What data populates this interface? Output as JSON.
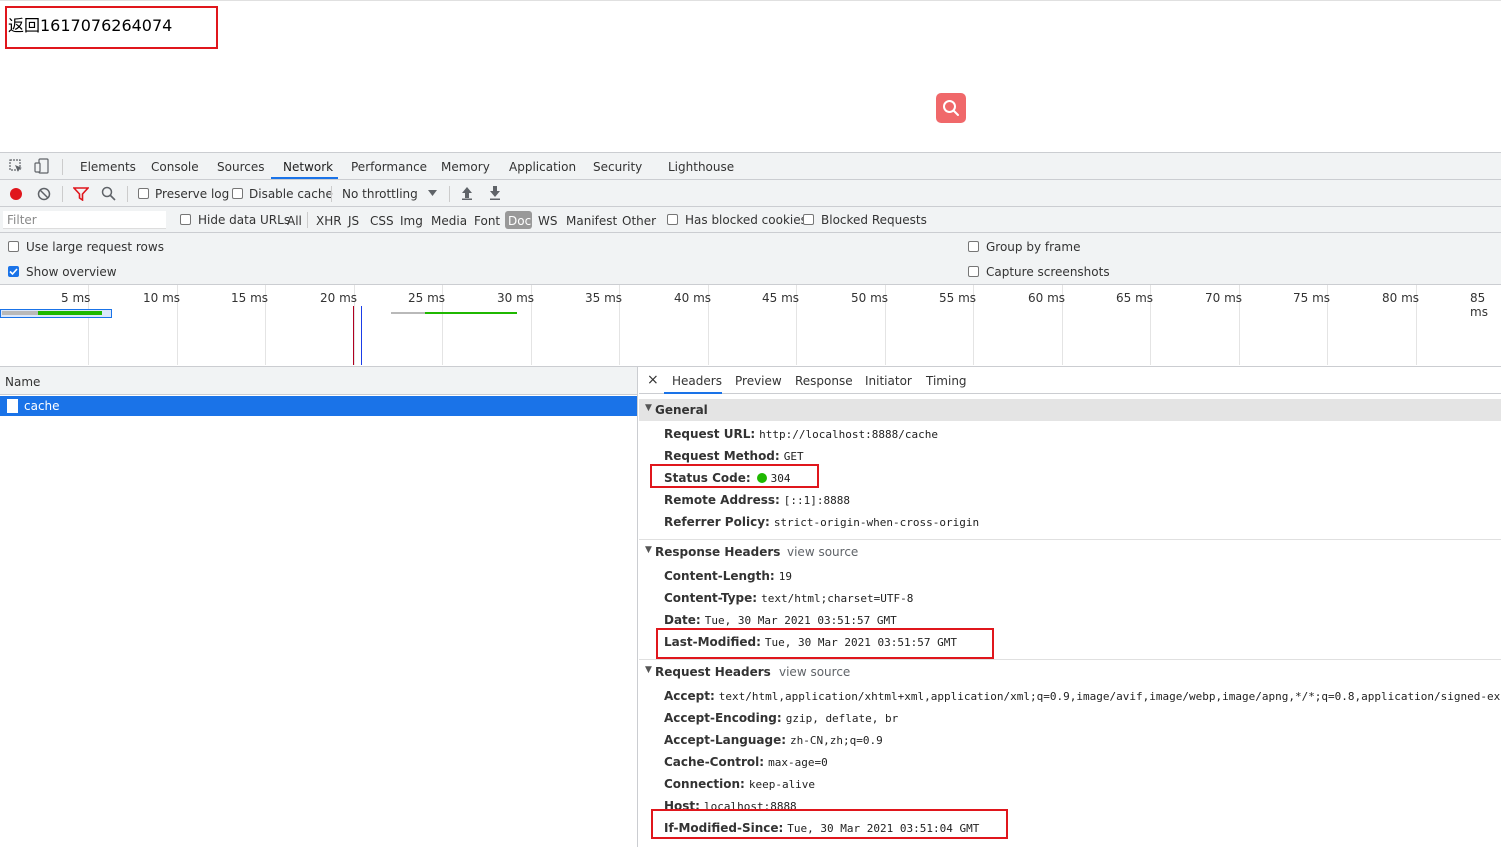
{
  "page": {
    "text": "返回1617076264074"
  },
  "devtools": {
    "tabs": [
      "Elements",
      "Console",
      "Sources",
      "Network",
      "Performance",
      "Memory",
      "Application",
      "Security",
      "Lighthouse"
    ],
    "toolbar": {
      "preserve_log": "Preserve log",
      "disable_cache": "Disable cache",
      "throttling": "No throttling"
    },
    "filter": {
      "placeholder": "Filter",
      "hide_data_urls": "Hide data URLs",
      "types": [
        "All",
        "XHR",
        "JS",
        "CSS",
        "Img",
        "Media",
        "Font",
        "Doc",
        "WS",
        "Manifest",
        "Other"
      ],
      "selected_type": "Doc",
      "has_blocked_cookies": "Has blocked cookies",
      "blocked_requests": "Blocked Requests"
    },
    "options": {
      "use_large_rows": "Use large request rows",
      "show_overview": "Show overview",
      "group_by_frame": "Group by frame",
      "capture_screenshots": "Capture screenshots"
    },
    "overview": {
      "ticks": [
        "5 ms",
        "10 ms",
        "15 ms",
        "20 ms",
        "25 ms",
        "30 ms",
        "35 ms",
        "40 ms",
        "45 ms",
        "50 ms",
        "55 ms",
        "60 ms",
        "65 ms",
        "70 ms",
        "75 ms",
        "80 ms",
        "85 ms"
      ]
    },
    "requests": {
      "column_name": "Name",
      "rows": [
        "cache"
      ]
    },
    "details": {
      "tabs": [
        "Headers",
        "Preview",
        "Response",
        "Initiator",
        "Timing"
      ],
      "close": "×",
      "general": {
        "title": "General",
        "rows": [
          {
            "key": "Request URL:",
            "value": "http://localhost:8888/cache"
          },
          {
            "key": "Request Method:",
            "value": "GET"
          },
          {
            "key": "Status Code:",
            "value": "304"
          },
          {
            "key": "Remote Address:",
            "value": "[::1]:8888"
          },
          {
            "key": "Referrer Policy:",
            "value": "strict-origin-when-cross-origin"
          }
        ]
      },
      "response_headers": {
        "title": "Response Headers",
        "view_source": "view source",
        "rows": [
          {
            "key": "Content-Length:",
            "value": "19"
          },
          {
            "key": "Content-Type:",
            "value": "text/html;charset=UTF-8"
          },
          {
            "key": "Date:",
            "value": "Tue, 30 Mar 2021 03:51:57 GMT"
          },
          {
            "key": "Last-Modified:",
            "value": "Tue, 30 Mar 2021 03:51:57 GMT"
          }
        ]
      },
      "request_headers": {
        "title": "Request Headers",
        "view_source": "view source",
        "rows": [
          {
            "key": "Accept:",
            "value": "text/html,application/xhtml+xml,application/xml;q=0.9,image/avif,image/webp,image/apng,*/*;q=0.8,application/signed-exch"
          },
          {
            "key": "Accept-Encoding:",
            "value": "gzip, deflate, br"
          },
          {
            "key": "Accept-Language:",
            "value": "zh-CN,zh;q=0.9"
          },
          {
            "key": "Cache-Control:",
            "value": "max-age=0"
          },
          {
            "key": "Connection:",
            "value": "keep-alive"
          },
          {
            "key": "Host:",
            "value": "localhost:8888"
          },
          {
            "key": "If-Modified-Since:",
            "value": "Tue, 30 Mar 2021 03:51:04 GMT"
          }
        ]
      }
    }
  },
  "colors": {
    "accent": "#1a73e8",
    "highlight_box": "#e0161c",
    "search_button": "#f0686a",
    "status_ok": "#1fb800"
  }
}
